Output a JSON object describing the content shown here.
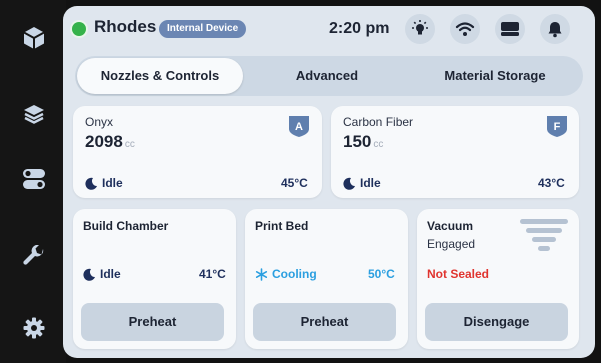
{
  "header": {
    "device_name": "Rhodes",
    "badge": "Internal Device",
    "time": "2:20 pm",
    "connection_color": "#35b24a"
  },
  "sidebar": {
    "items": [
      {
        "icon": "cube-icon"
      },
      {
        "icon": "layers-icon"
      },
      {
        "icon": "toggles-icon"
      },
      {
        "icon": "wrench-icon"
      },
      {
        "icon": "gear-icon"
      }
    ]
  },
  "tabs": [
    {
      "label": "Nozzles & Controls",
      "active": true
    },
    {
      "label": "Advanced",
      "active": false
    },
    {
      "label": "Material Storage",
      "active": false
    }
  ],
  "materials": [
    {
      "name": "Onyx",
      "amount": "2098",
      "unit": "cc",
      "slot": "A",
      "state": "Idle",
      "temp": "45°C"
    },
    {
      "name": "Carbon Fiber",
      "amount": "150",
      "unit": "cc",
      "slot": "F",
      "state": "Idle",
      "temp": "43°C"
    }
  ],
  "build_chamber": {
    "title": "Build Chamber",
    "state": "Idle",
    "temp": "41°C",
    "button": "Preheat"
  },
  "print_bed": {
    "title": "Print Bed",
    "state": "Cooling",
    "temp": "50°C",
    "button": "Preheat"
  },
  "vacuum": {
    "title": "Vacuum",
    "status": "Engaged",
    "seal": "Not Sealed",
    "button": "Disengage"
  },
  "colors": {
    "cooling": "#2b9fe0",
    "alert": "#e0342f",
    "slot_badge": "#5f7fae"
  }
}
